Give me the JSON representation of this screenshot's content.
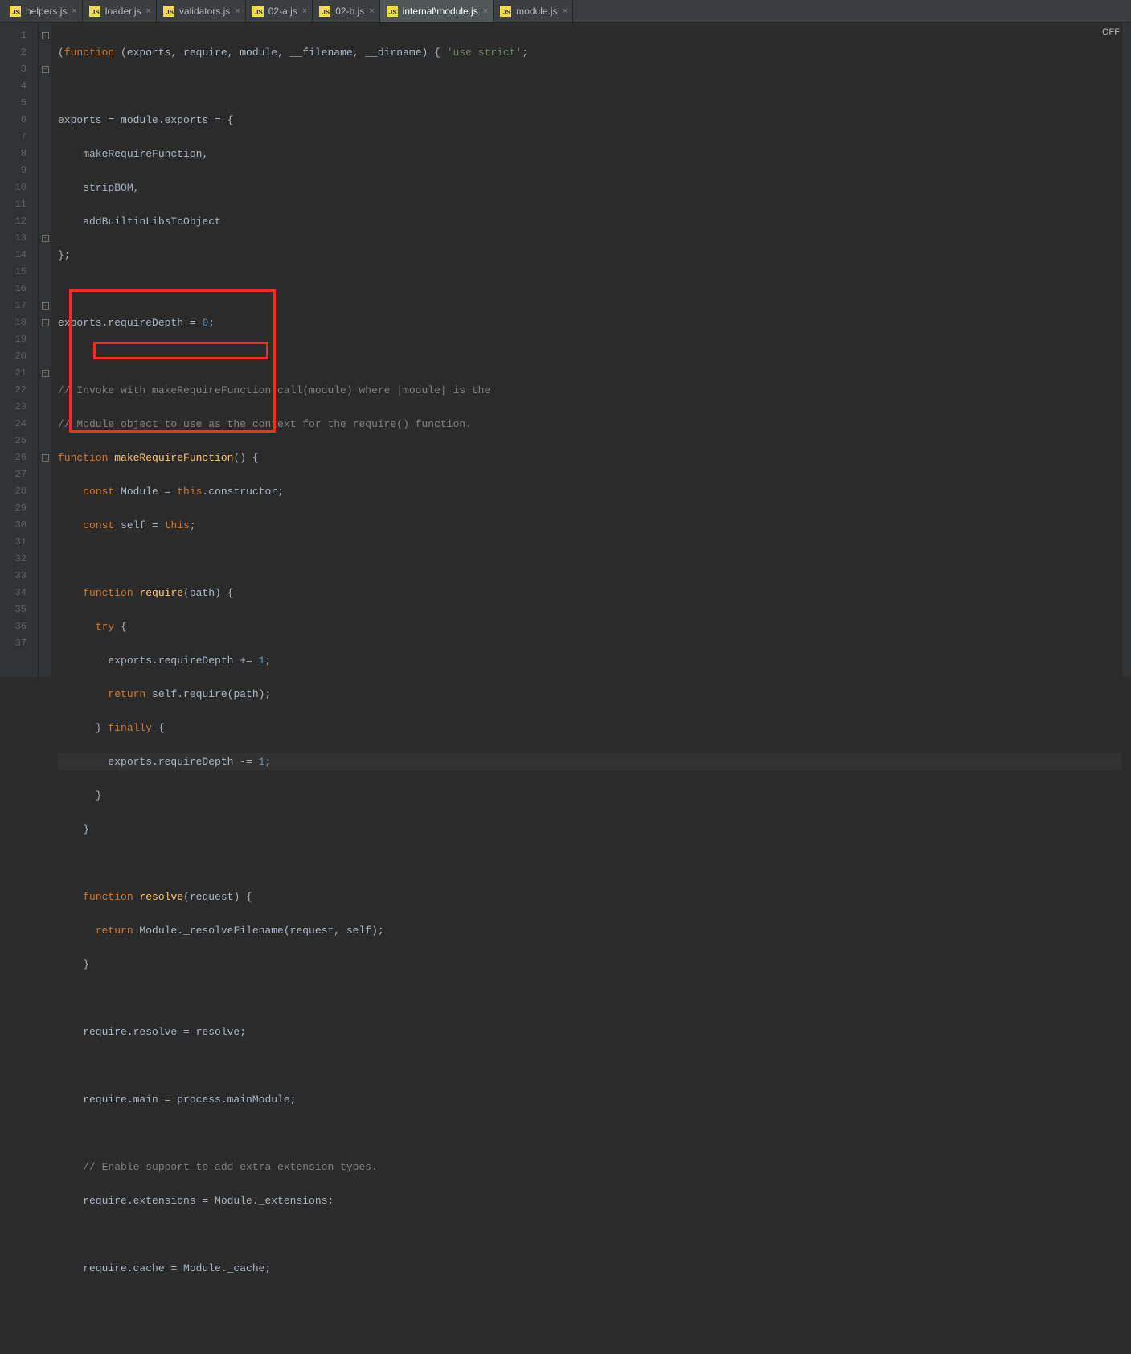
{
  "tabs": [
    {
      "label": "helpers.js"
    },
    {
      "label": "loader.js"
    },
    {
      "label": "validators.js"
    },
    {
      "label": "02-a.js"
    },
    {
      "label": "02-b.js"
    },
    {
      "label": "internal\\module.js"
    },
    {
      "label": "module.js"
    }
  ],
  "status_off": "OFF",
  "line_numbers": [
    "1",
    "2",
    "3",
    "4",
    "5",
    "6",
    "7",
    "8",
    "9",
    "10",
    "11",
    "12",
    "13",
    "14",
    "15",
    "16",
    "17",
    "18",
    "19",
    "20",
    "21",
    "22",
    "23",
    "24",
    "25",
    "26",
    "27",
    "28",
    "29",
    "30",
    "31",
    "32",
    "33",
    "34",
    "35",
    "36",
    "37"
  ],
  "code": {
    "l1_a": "(",
    "l1_kw": "function ",
    "l1_b": "(exports, require, module, __filename, __dirname) { ",
    "l1_str": "'use strict'",
    "l1_c": ";",
    "l3": "exports = module.exports = {",
    "l4": "    makeRequireFunction,",
    "l5": "    stripBOM,",
    "l6": "    addBuiltinLibsToObject",
    "l7": "};",
    "l9_a": "exports.requireDepth = ",
    "l9_n": "0",
    "l9_b": ";",
    "l11": "// Invoke with makeRequireFunction.call(module) where |module| is the",
    "l12": "// Module object to use as the context for the require() function.",
    "l13_kw": "function ",
    "l13_fn": "makeRequireFunction",
    "l13_b": "() {",
    "l14_a": "    ",
    "l14_kw": "const ",
    "l14_b": "Module = ",
    "l14_kw2": "this",
    "l14_c": ".constructor;",
    "l15_a": "    ",
    "l15_kw": "const ",
    "l15_b": "self = ",
    "l15_kw2": "this",
    "l15_c": ";",
    "l17_a": "    ",
    "l17_kw": "function ",
    "l17_fn": "require",
    "l17_b": "(path) {",
    "l18_a": "      ",
    "l18_kw": "try ",
    "l18_b": "{",
    "l19_a": "        exports.requireDepth += ",
    "l19_n": "1",
    "l19_b": ";",
    "l20_a": "        ",
    "l20_kw": "return ",
    "l20_b": "self.require(path);",
    "l21_a": "      } ",
    "l21_kw": "finally ",
    "l21_b": "{",
    "l22_a": "        exports.requireDepth -= ",
    "l22_n": "1",
    "l22_b": ";",
    "l23": "      }",
    "l24": "    }",
    "l26_a": "    ",
    "l26_kw": "function ",
    "l26_fn": "resolve",
    "l26_b": "(request) {",
    "l27_a": "      ",
    "l27_kw": "return ",
    "l27_b": "Module._resolveFilename(request, self);",
    "l28": "    }",
    "l30": "    require.resolve = resolve;",
    "l32": "    require.main = process.mainModule;",
    "l34": "    // Enable support to add extra extension types.",
    "l35": "    require.extensions = Module._extensions;",
    "l37": "    require.cache = Module._cache;"
  }
}
